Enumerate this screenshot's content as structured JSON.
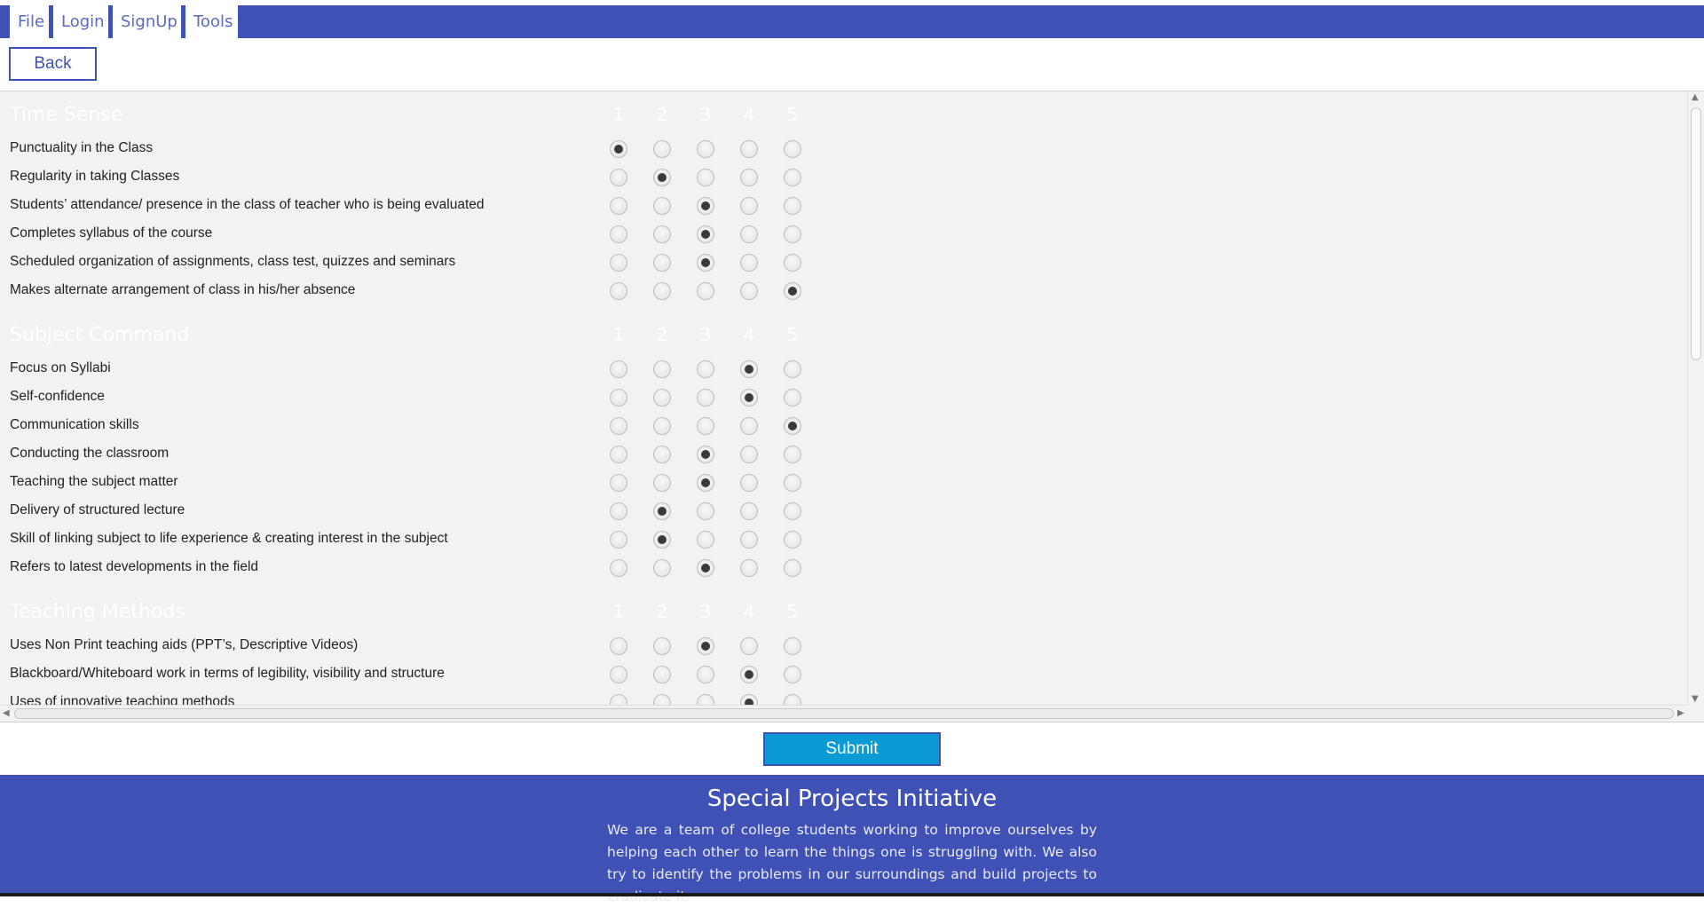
{
  "menu": {
    "items": [
      {
        "label": "File"
      },
      {
        "label": "Login"
      },
      {
        "label": "SignUp"
      },
      {
        "label": "Tools"
      }
    ]
  },
  "back_label": "Back",
  "submit_label": "Submit",
  "scale_labels": [
    "1",
    "2",
    "3",
    "4",
    "5"
  ],
  "sections": [
    {
      "title": "Time Sense",
      "questions": [
        {
          "label": "Punctuality in the Class",
          "rating": 1
        },
        {
          "label": "Regularity in taking Classes",
          "rating": 2
        },
        {
          "label": "Students’ attendance/ presence in the class of teacher who is being evaluated",
          "rating": 3
        },
        {
          "label": "Completes syllabus of the course",
          "rating": 3
        },
        {
          "label": "Scheduled organization of assignments, class test, quizzes and seminars",
          "rating": 3
        },
        {
          "label": "Makes alternate arrangement of class in his/her absence",
          "rating": 5
        }
      ]
    },
    {
      "title": "Subject Command",
      "questions": [
        {
          "label": "Focus on Syllabi",
          "rating": 4
        },
        {
          "label": "Self-confidence",
          "rating": 4
        },
        {
          "label": "Communication skills",
          "rating": 5
        },
        {
          "label": "Conducting the classroom",
          "rating": 3
        },
        {
          "label": "Teaching the subject matter",
          "rating": 3
        },
        {
          "label": "Delivery of structured lecture",
          "rating": 2
        },
        {
          "label": "Skill of linking subject to life experience & creating interest in the subject",
          "rating": 2
        },
        {
          "label": "Refers to latest developments in the field",
          "rating": 3
        }
      ]
    },
    {
      "title": "Teaching Methods",
      "questions": [
        {
          "label": "Uses Non Print teaching aids (PPT’s, Descriptive Videos)",
          "rating": 3
        },
        {
          "label": "Blackboard/Whiteboard work in terms of legibility, visibility and structure",
          "rating": 4
        },
        {
          "label": "Uses of innovative teaching methods",
          "rating": 4
        },
        {
          "label": "",
          "rating": 0
        }
      ]
    }
  ],
  "footer": {
    "title": "Special Projects Initiative",
    "text": "We are a team of college students working to improve ourselves by helping each other to learn the things one is struggling with. We also try to identify the problems in our surroundings and build projects to eradicate it."
  },
  "colors": {
    "primary": "#3f51b5",
    "submit": "#0a9ad4",
    "panel": "#f2f2f2"
  }
}
